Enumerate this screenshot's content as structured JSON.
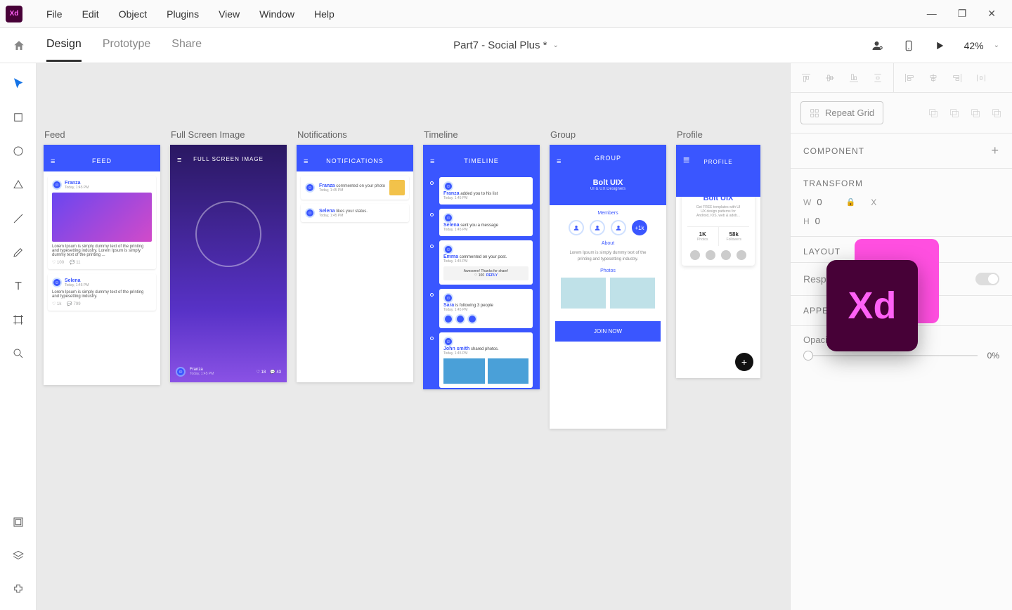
{
  "menu": {
    "items": [
      "File",
      "Edit",
      "Object",
      "Plugins",
      "View",
      "Window",
      "Help"
    ]
  },
  "window_controls": {
    "minimize": "—",
    "maximize": "❐",
    "close": "✕"
  },
  "modebar": {
    "tabs": [
      "Design",
      "Prototype",
      "Share"
    ],
    "active": 0,
    "document_title": "Part7 - Social Plus *",
    "zoom": "42%"
  },
  "tools": [
    "select",
    "rectangle",
    "ellipse",
    "polygon",
    "line",
    "pen",
    "text",
    "artboard",
    "zoom"
  ],
  "bottom_tools": [
    "assets",
    "layers",
    "plugins"
  ],
  "artboards": [
    {
      "label": "Feed",
      "header": "FEED",
      "post1": {
        "name": "Franza",
        "date": "Today, 1:45 PM",
        "text": "Lorem Ipsum is simply dummy text of the printing and typesetting industry. Lorem Ipsum is simply dummy text of the printing ...",
        "likes": "100",
        "comments": "11"
      },
      "post2": {
        "name": "Selena",
        "date": "Today, 1:45 PM",
        "text": "Lorem Ipsum is simply dummy text of the printing and typesetting industry.",
        "likes": "1k",
        "comments": "799"
      }
    },
    {
      "label": "Full Screen Image",
      "header": "FULL SCREEN IMAGE",
      "user": "Franza",
      "date": "Today, 1:45 PM",
      "likes": "18",
      "comments": "43"
    },
    {
      "label": "Notifications",
      "header": "NOTIFICATIONS",
      "n1": {
        "name": "Franza",
        "text": "commented on your photo",
        "date": "Today, 1:45 PM"
      },
      "n2": {
        "name": "Selena",
        "text": "likes your status.",
        "date": "Today, 1:45 PM"
      }
    },
    {
      "label": "Timeline",
      "header": "TIMELINE",
      "t1": {
        "name": "Franza",
        "text": "added you to his list",
        "date": "Today, 1:45 PM"
      },
      "t2": {
        "name": "Selena",
        "text": "sent you a message",
        "date": "Today, 1:45 PM"
      },
      "t3": {
        "name": "Emma",
        "text": "commented on your post.",
        "date": "Today, 1:45 PM",
        "sub": "Awesome! Thanks for share!",
        "sub_likes": "100",
        "reply": "REPLY"
      },
      "t4": {
        "name": "Sara",
        "text": "is following 3 people",
        "date": "Today, 1:45 PM"
      },
      "t5": {
        "name": "John smith",
        "text": "shared photos.",
        "date": "Today, 1:45 PM"
      }
    },
    {
      "label": "Group",
      "header": "GROUP",
      "title": "Bolt UIX",
      "subtitle": "UI & UX Designers",
      "members": "Members",
      "members_plus": "+1k",
      "about": "About",
      "about_text": "Lorem Ipsum is simply dummy text of the printing and typesetting industry.",
      "photos": "Photos",
      "join": "JOIN NOW"
    },
    {
      "label": "Profile",
      "header": "PROFILE",
      "name": "Bolt UIX",
      "desc": "Get FREE templates with UI UX design patterns for Android, IOS, web & adob...",
      "stat1": {
        "n": "1K",
        "l": "Photos"
      },
      "stat2": {
        "n": "58k",
        "l": "Followers"
      }
    }
  ],
  "right_panel": {
    "repeat_grid": "Repeat Grid",
    "component": "COMPONENT",
    "transform": "TRANSFORM",
    "w": "W",
    "w_val": "0",
    "x": "X",
    "h": "H",
    "h_val": "0",
    "layout": "LAYOUT",
    "responsive": "Responsive Resize",
    "appearance": "APPEARANCE",
    "opacity": "Opacity",
    "opacity_val": "0%"
  }
}
